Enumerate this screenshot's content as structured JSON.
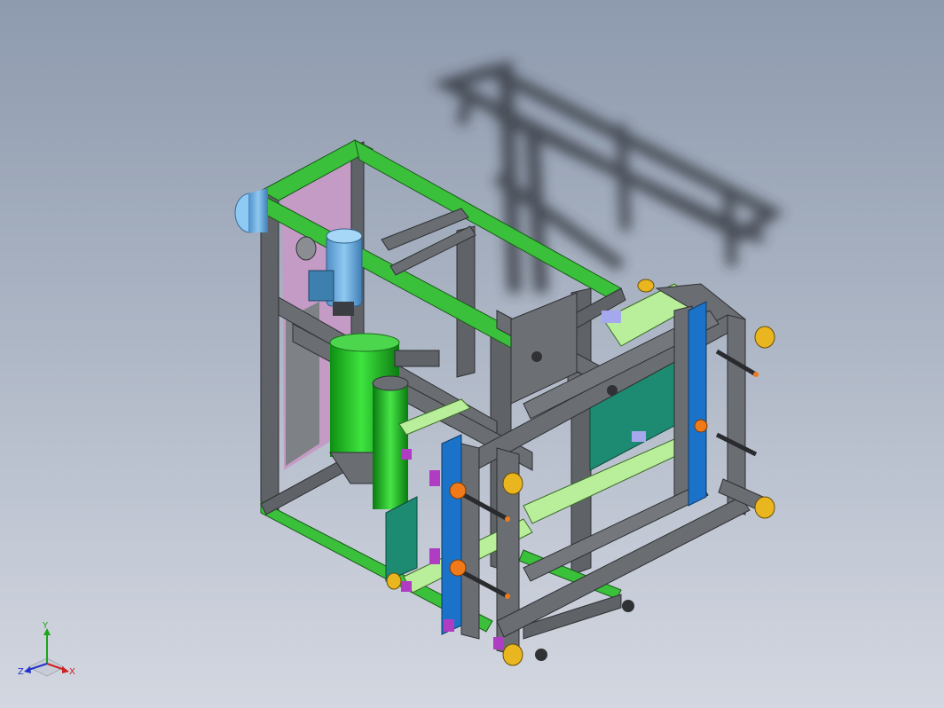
{
  "viewport": {
    "background_top": "#8e9aae",
    "background_bottom": "#d3d7e0"
  },
  "triad": {
    "y_label": "Y",
    "z_label": "Z",
    "x_label": "X",
    "y_color": "#1aa51a",
    "z_color": "#2233cc",
    "x_color": "#cc2222"
  },
  "model_colors": {
    "frame_profile": "#5f6266",
    "frame_highlight": "#3ac03a",
    "panel_pink": "#c39bc5",
    "motor_blue": "#79b8e6",
    "roller_green": "#27c12a",
    "plate_blue": "#1a73c9",
    "plate_light_green": "#b9ee9a",
    "teal_belt": "#1d8a72",
    "bolt_orange": "#f07a1a",
    "clamp_magenta": "#b03cc4",
    "knob_yellow": "#e9b620"
  }
}
